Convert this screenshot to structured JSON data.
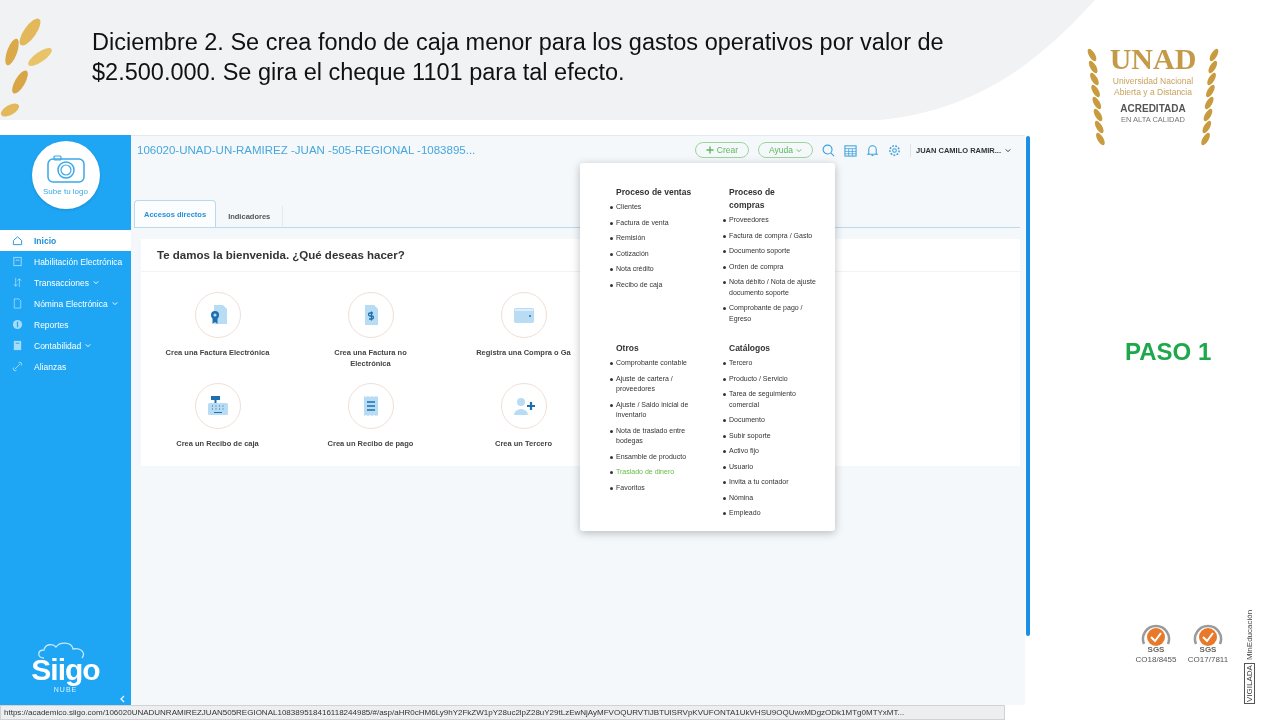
{
  "slide": {
    "heading": "Diciembre 2. Se crea fondo de caja menor para los gastos operativos por valor de $2.500.000. Se gira el cheque 1101 para tal efecto.",
    "step": "PASO 1"
  },
  "unad_logo": {
    "name": "UNAD",
    "line_1": "Universidad Nacional",
    "line_2": "Abierta y a Distancia",
    "accreditation": "ACREDITADA",
    "accreditation_sub": "EN ALTA CALIDAD"
  },
  "certifications": [
    {
      "mark": "SGS",
      "code": "CO18/8455"
    },
    {
      "mark": "SGS",
      "code": "CO17/7811"
    }
  ],
  "vigilance": {
    "badge": "VIGILADA",
    "ministry": "MinEducación"
  },
  "app": {
    "sidebar": {
      "logo_caption": "Sube tu logo",
      "items": [
        {
          "label": "Inicio",
          "selected": true,
          "expandable": false
        },
        {
          "label": "Habilitación Electrónica",
          "selected": false,
          "expandable": false
        },
        {
          "label": "Transacciones",
          "selected": false,
          "expandable": true
        },
        {
          "label": "Nómina Electrónica",
          "selected": false,
          "expandable": true
        },
        {
          "label": "Reportes",
          "selected": false,
          "expandable": false
        },
        {
          "label": "Contabilidad",
          "selected": false,
          "expandable": true
        },
        {
          "label": "Alianzas",
          "selected": false,
          "expandable": false
        }
      ],
      "brand": "Siigo",
      "brand_sub": "NUBE"
    },
    "company": "106020-UNAD-UN-RAMIREZ -JUAN -505-REGIONAL -1083895...",
    "create_button": "Crear",
    "help_button": "Ayuda",
    "user": "JUAN CAMILO RAMIR...",
    "tabs": [
      {
        "label": "Accesos directos",
        "selected": true
      },
      {
        "label": "Indicadores",
        "selected": false
      }
    ],
    "welcome": "Te damos la bienvenida. ¿Qué deseas hacer?",
    "shortcuts": [
      {
        "label": "Crea una Factura Electrónica"
      },
      {
        "label": "Crea una Factura no Electrónica"
      },
      {
        "label": "Registra una Compra o Ga"
      },
      {
        "label": "Crea un Recibo de caja"
      },
      {
        "label": "Crea un Recibo de pago"
      },
      {
        "label": "Crea un Tercero"
      }
    ],
    "create_menu": {
      "sections": [
        {
          "title": "Proceso de ventas",
          "items": [
            {
              "label": "Clientes",
              "selected": false
            },
            {
              "label": "Factura de venta",
              "selected": false
            },
            {
              "label": "Remisión",
              "selected": false
            },
            {
              "label": "Cotización",
              "selected": false
            },
            {
              "label": "Nota crédito",
              "selected": false
            },
            {
              "label": "Recibo de caja",
              "selected": false
            }
          ]
        },
        {
          "title": "Proceso de compras",
          "items": [
            {
              "label": "Proveedores",
              "selected": false
            },
            {
              "label": "Factura de compra / Gasto",
              "selected": false
            },
            {
              "label": "Documento soporte",
              "selected": false
            },
            {
              "label": "Orden de compra",
              "selected": false
            },
            {
              "label": "Nota débito / Nota de ajuste documento soporte",
              "selected": false
            },
            {
              "label": "Comprobante de pago / Egreso",
              "selected": false
            }
          ]
        },
        {
          "title": "Otros",
          "items": [
            {
              "label": "Comprobante contable",
              "selected": false
            },
            {
              "label": "Ajuste de cartera / proveedores",
              "selected": false
            },
            {
              "label": "Ajuste / Saldo inicial de inventario",
              "selected": false
            },
            {
              "label": "Nota de traslado entre bodegas",
              "selected": false
            },
            {
              "label": "Ensamble de producto",
              "selected": false
            },
            {
              "label": "Traslado de dinero",
              "selected": true
            },
            {
              "label": "Favoritos",
              "selected": false
            }
          ]
        },
        {
          "title": "Catálogos",
          "items": [
            {
              "label": "Tercero",
              "selected": false
            },
            {
              "label": "Producto / Servicio",
              "selected": false
            },
            {
              "label": "Tarea de seguimiento comercial",
              "selected": false
            },
            {
              "label": "Documento",
              "selected": false
            },
            {
              "label": "Subir soporte",
              "selected": false
            },
            {
              "label": "Activo fijo",
              "selected": false
            },
            {
              "label": "Usuario",
              "selected": false
            },
            {
              "label": "Invita a tu contador",
              "selected": false
            },
            {
              "label": "Nómina",
              "selected": false
            },
            {
              "label": "Empleado",
              "selected": false
            }
          ]
        }
      ]
    },
    "status_url": "https://academico.siigo.com/106020UNADUNRAMIREZJUAN505REGIONAL108389518416118244985/#/asp/aHR0cHM6Ly9hY2FkZW1pY28uc2lpZ28uY29tLzEwNjAyMFVOQURVTlJBTUlSRVpKVUFONTA1UkVHSU9OQUwxMDgzODk1MTg0MTYxMT..."
  }
}
